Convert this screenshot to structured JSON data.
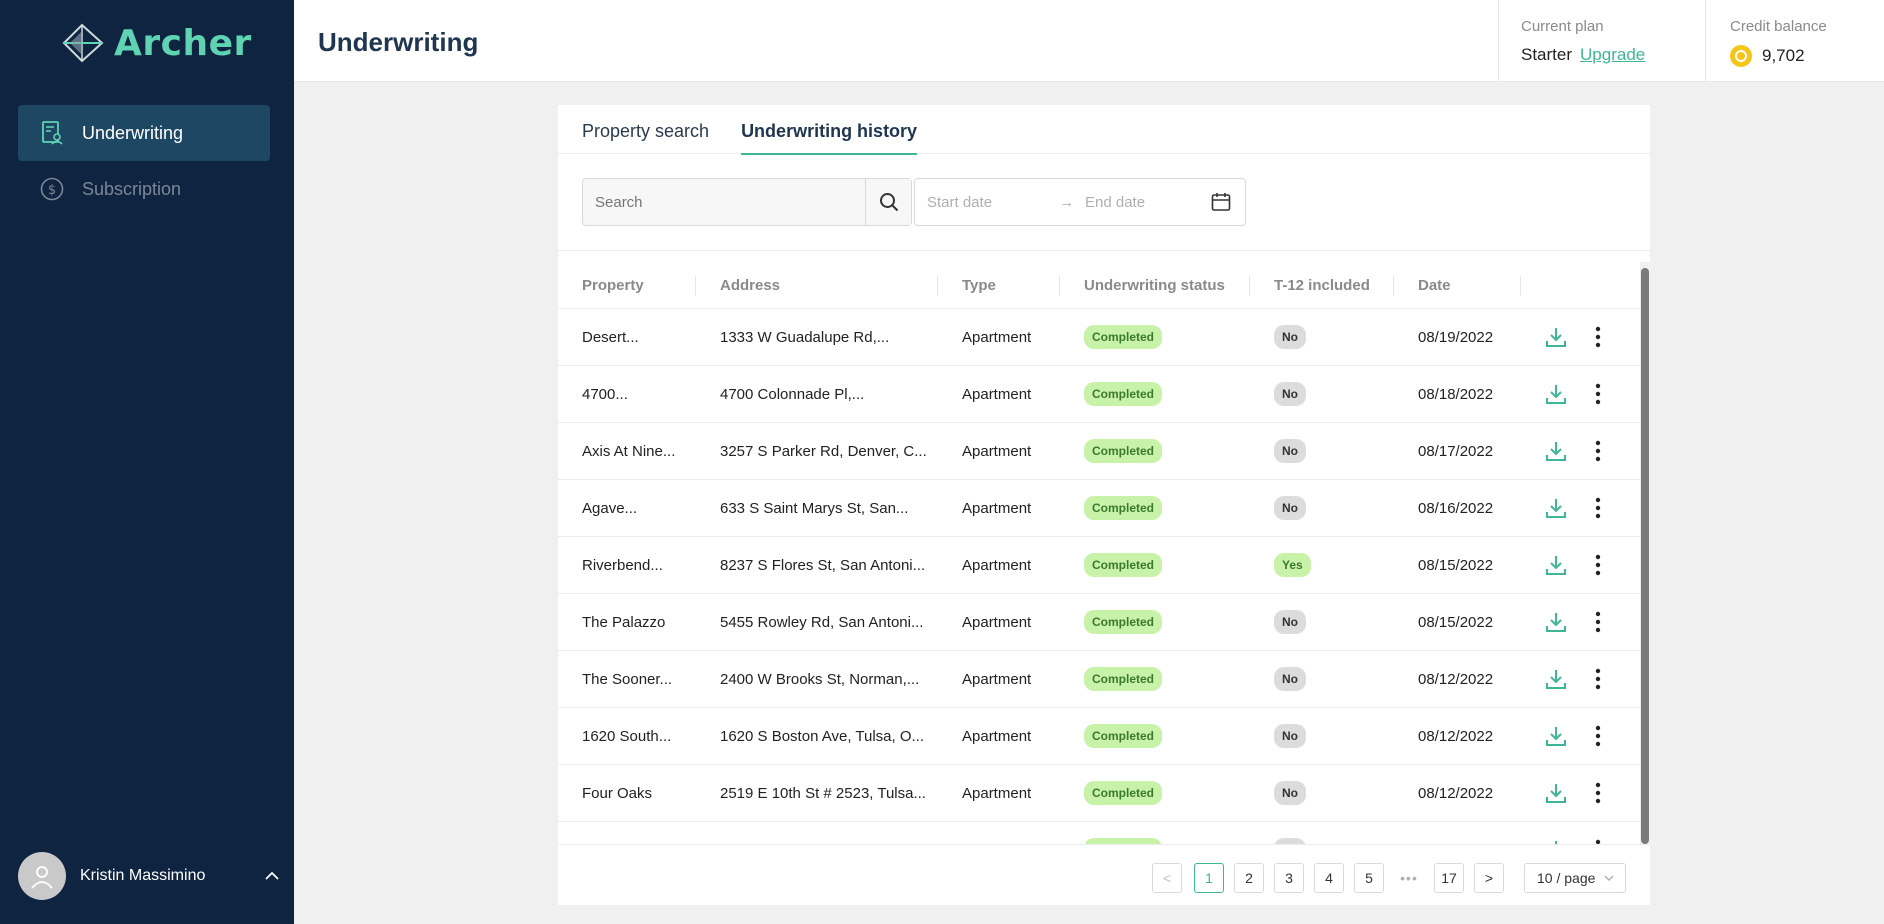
{
  "app": {
    "brand": "Archer"
  },
  "sidebar": {
    "items": [
      {
        "label": "Underwriting",
        "icon": "document-user-icon"
      },
      {
        "label": "Subscription",
        "icon": "dollar-circle-icon"
      }
    ],
    "user": {
      "name": "Kristin Massimino"
    }
  },
  "header": {
    "title": "Underwriting",
    "plan_label": "Current plan",
    "plan_value": "Starter",
    "upgrade_label": "Upgrade",
    "credit_label": "Credit balance",
    "credit_value": "9,702"
  },
  "tabs": [
    {
      "label": "Property search",
      "active": false
    },
    {
      "label": "Underwriting history",
      "active": true
    }
  ],
  "filters": {
    "search_placeholder": "Search",
    "start_date_placeholder": "Start date",
    "arrow": "→",
    "end_date_placeholder": "End date"
  },
  "table": {
    "headers": [
      "Property",
      "Address",
      "Type",
      "Underwriting status",
      "T-12 included",
      "Date"
    ],
    "rows": [
      {
        "property": "Desert...",
        "address": "1333 W Guadalupe Rd,...",
        "type": "Apartment",
        "status": "Completed",
        "t12": "No",
        "date": "08/19/2022"
      },
      {
        "property": "4700...",
        "address": "4700 Colonnade Pl,...",
        "type": "Apartment",
        "status": "Completed",
        "t12": "No",
        "date": "08/18/2022"
      },
      {
        "property": "Axis At Nine...",
        "address": "3257 S Parker Rd, Denver, C...",
        "type": "Apartment",
        "status": "Completed",
        "t12": "No",
        "date": "08/17/2022"
      },
      {
        "property": "Agave...",
        "address": "633 S Saint Marys St, San...",
        "type": "Apartment",
        "status": "Completed",
        "t12": "No",
        "date": "08/16/2022"
      },
      {
        "property": "Riverbend...",
        "address": "8237 S Flores St, San Antoni...",
        "type": "Apartment",
        "status": "Completed",
        "t12": "Yes",
        "date": "08/15/2022"
      },
      {
        "property": "The Palazzo",
        "address": "5455 Rowley Rd, San Antoni...",
        "type": "Apartment",
        "status": "Completed",
        "t12": "No",
        "date": "08/15/2022"
      },
      {
        "property": "The Sooner...",
        "address": "2400 W Brooks St, Norman,...",
        "type": "Apartment",
        "status": "Completed",
        "t12": "No",
        "date": "08/12/2022"
      },
      {
        "property": "1620 South...",
        "address": "1620 S Boston Ave, Tulsa, O...",
        "type": "Apartment",
        "status": "Completed",
        "t12": "No",
        "date": "08/12/2022"
      },
      {
        "property": "Four Oaks",
        "address": "2519 E 10th St # 2523, Tulsa...",
        "type": "Apartment",
        "status": "Completed",
        "t12": "No",
        "date": "08/12/2022"
      },
      {
        "property": "",
        "address": "",
        "type": "",
        "status": "Completed",
        "t12": "No",
        "date": ""
      }
    ]
  },
  "pagination": {
    "prev": "<",
    "pages": [
      "1",
      "2",
      "3",
      "4",
      "5"
    ],
    "ellipsis": "•••",
    "last": "17",
    "next": ">",
    "current": "1",
    "page_size": "10 / page"
  },
  "colors": {
    "sidebar_bg": "#0f2440",
    "accent": "#3fb697",
    "active_nav": "#1e4763"
  }
}
